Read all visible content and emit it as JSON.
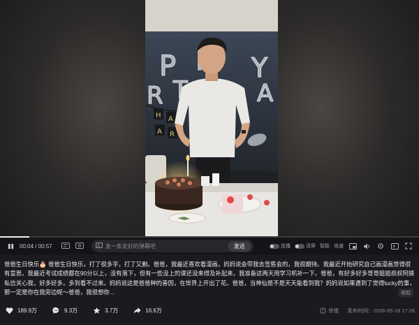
{
  "player": {
    "time_current": "00:04",
    "time_total": "00:57",
    "progress": 0.07,
    "danmaku_placeholder": "发一条友好的弹幕吧",
    "send_label": "发送",
    "toggle_1": "连播",
    "toggle_2": "清屏",
    "smart": "智能",
    "speed": "倍速"
  },
  "description": {
    "text": "爸爸生日快乐🎂 爸爸生日快乐，打了很多字，打了又删。爸爸，我最近喜欢看漫画，妈妈说会带我去签售会的，我很期待。我最近开始研究自己画漫画觉得很有意思。我最近考试成绩都在90分以上，没有落下，但有一些没上的课还没来得及补起来，我准备这两天用学习机补一下。爸爸，有好多好多哥哥姐姐叔叔阿姨私信关心我，好多好多，多到看不过来。妈妈说这是爸爸种的善因，在世界上开出了花。爸爸，当神仙是不是天天能看到我？妈妈说如果遇到了觉得lucky的事，那一定是你在我旁边呢～爸爸，我很想你…",
    "collapse_label": "收起"
  },
  "stats": {
    "likes": "189.9万",
    "comments": "9.3万",
    "favorites": "3.7万",
    "shares": "16.6万",
    "report_label": "举报",
    "publish_time": "发布时间：2026-05-18 17:26"
  },
  "scene": {
    "balloon_letters": [
      "P",
      "P",
      "Y",
      "R",
      "T",
      "A",
      "Y"
    ],
    "banner_letters": [
      "H",
      "A",
      "A",
      "R"
    ]
  }
}
